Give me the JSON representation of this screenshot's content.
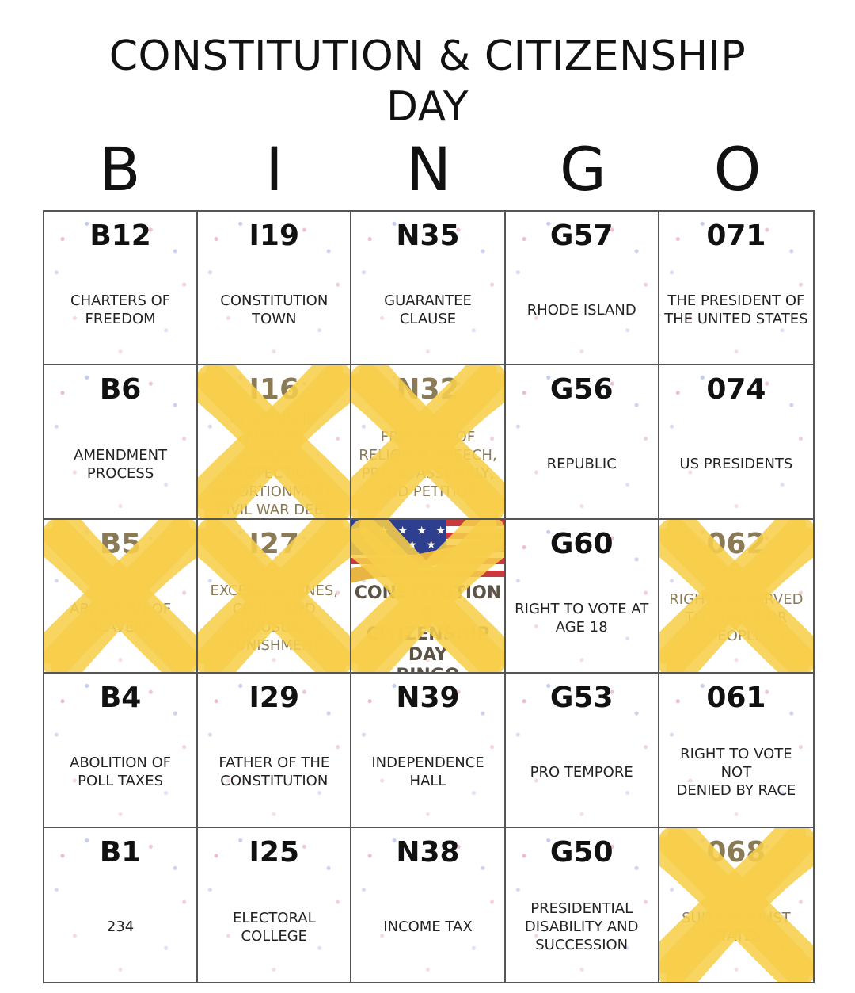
{
  "title": {
    "line1": "CONSTITUTION & CITIZENSHIP",
    "line2": "DAY"
  },
  "letters": [
    "B",
    "I",
    "N",
    "G",
    "O"
  ],
  "mark_color": "#F7CE4A",
  "board": [
    [
      {
        "code": "B12",
        "text": "CHARTERS OF\nFREEDOM",
        "marked": false
      },
      {
        "code": "I19",
        "text": "CONSTITUTION\nTOWN",
        "marked": false
      },
      {
        "code": "N35",
        "text": "GUARANTEE\nCLAUSE",
        "marked": false
      },
      {
        "code": "G57",
        "text": "RHODE ISLAND",
        "marked": false
      },
      {
        "code": "071",
        "text": "THE PRESIDENT OF\nTHE UNITED STATES",
        "marked": false
      }
    ],
    [
      {
        "code": "B6",
        "text": "AMENDMENT\nPROCESS",
        "marked": false
      },
      {
        "code": "I16",
        "text": "CITIZENSHIP RIGHTS,\nEQUAL PROTECTION,\nAPPORTIONMENT,\nCIVIL WAR DEBT",
        "marked": true
      },
      {
        "code": "N32",
        "text": "FREEDOM OF\nRELIGION, SPEECH,\nPRESS, ASSEMBLY,\nAND PETITION",
        "marked": true
      },
      {
        "code": "G56",
        "text": "REPUBLIC",
        "marked": false
      },
      {
        "code": "074",
        "text": "US PRESIDENTS",
        "marked": false
      }
    ],
    [
      {
        "code": "B5",
        "text": "ABOLITION OF\nSLAVERY",
        "marked": true
      },
      {
        "code": "I27",
        "text": "EXCESSIVE FINES,\nCRUEL AND\nUNUSUAL\nPUNISHMENT",
        "marked": true
      },
      {
        "free": true,
        "text": "CONSTITUTION &\nCITIZENSHIP DAY\nBINGO",
        "marked": true
      },
      {
        "code": "G60",
        "text": "RIGHT TO VOTE AT\nAGE 18",
        "marked": false
      },
      {
        "code": "062",
        "text": "RIGHTS RESERVED\nTO STATES OR\nPEOPLE",
        "marked": true
      }
    ],
    [
      {
        "code": "B4",
        "text": "ABOLITION OF\nPOLL TAXES",
        "marked": false
      },
      {
        "code": "I29",
        "text": "FATHER OF THE\nCONSTITUTION",
        "marked": false
      },
      {
        "code": "N39",
        "text": "INDEPENDENCE\nHALL",
        "marked": false
      },
      {
        "code": "G53",
        "text": "PRO TEMPORE",
        "marked": false
      },
      {
        "code": "061",
        "text": "RIGHT TO VOTE NOT\nDENIED BY RACE",
        "marked": false
      }
    ],
    [
      {
        "code": "B1",
        "text": "234",
        "marked": false
      },
      {
        "code": "I25",
        "text": "ELECTORAL COLLEGE",
        "marked": false
      },
      {
        "code": "N38",
        "text": "INCOME TAX",
        "marked": false
      },
      {
        "code": "G50",
        "text": "PRESIDENTIAL\nDISABILITY AND\nSUCCESSION",
        "marked": false
      },
      {
        "code": "068",
        "text": "SUITS AGAINST\nSTATES",
        "marked": true
      }
    ]
  ]
}
